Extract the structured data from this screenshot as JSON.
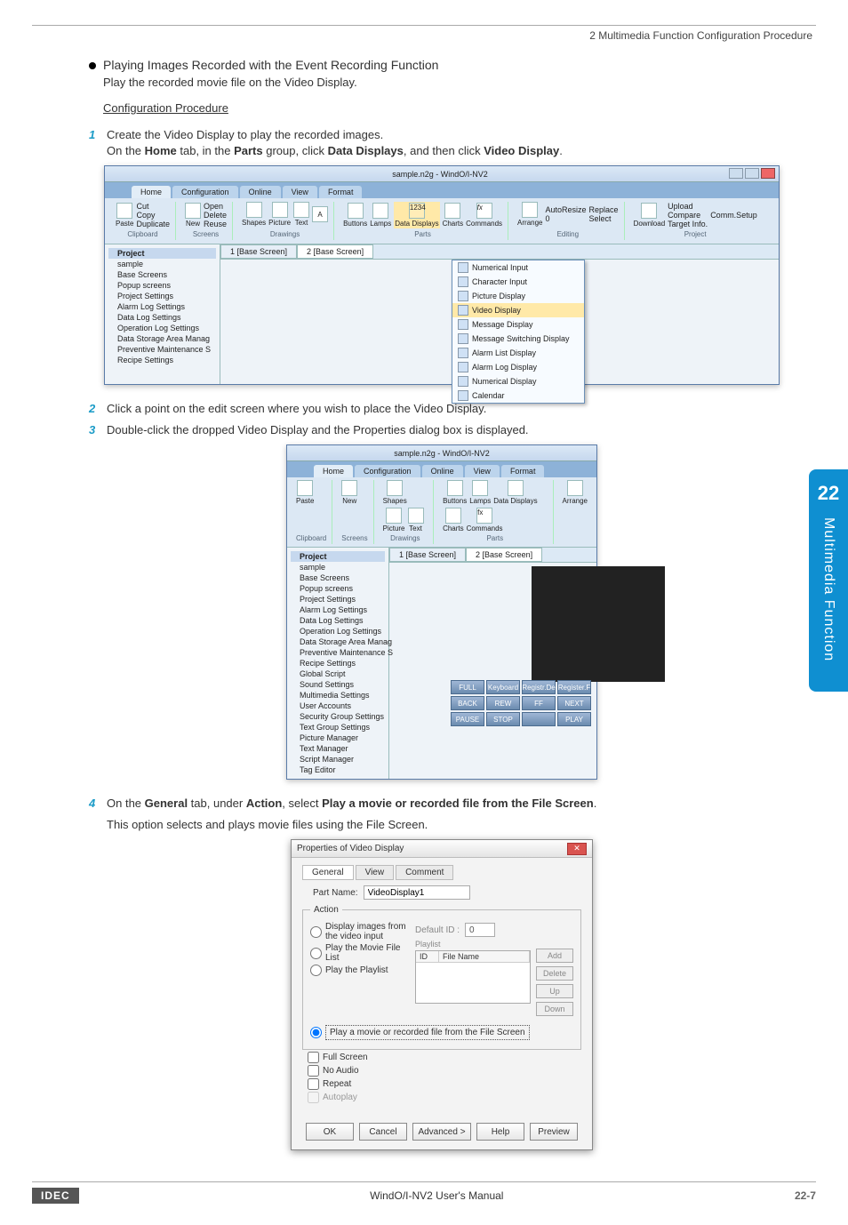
{
  "header": {
    "chapter": "2 Multimedia Function Configuration Procedure"
  },
  "section": {
    "bullet_title": "Playing Images Recorded with the Event Recording Function",
    "bullet_sub": "Play the recorded movie file on the Video Display.",
    "config_heading": "Configuration Procedure"
  },
  "steps": {
    "s1_num": "1",
    "s1_a": "Create the Video Display to play the recorded images.",
    "s1_b_pre": "On the ",
    "s1_b_home": "Home",
    "s1_b_mid1": " tab, in the ",
    "s1_b_parts": "Parts",
    "s1_b_mid2": " group, click ",
    "s1_b_dd": "Data Displays",
    "s1_b_mid3": ", and then click ",
    "s1_b_vd": "Video Display",
    "s1_b_end": ".",
    "s2_num": "2",
    "s2": "Click a point on the edit screen where you wish to place the Video Display.",
    "s3_num": "3",
    "s3": "Double-click the dropped Video Display and the Properties dialog box is displayed.",
    "s4_num": "4",
    "s4_pre": "On the ",
    "s4_general": "General",
    "s4_mid1": " tab, under ",
    "s4_action": "Action",
    "s4_mid2": ", select ",
    "s4_opt": "Play a movie or recorded file from the File Screen",
    "s4_end": ".",
    "s4_sub": "This option selects and plays movie files using the File Screen."
  },
  "app": {
    "title": "sample.n2g - WindO/I-NV2",
    "tabs": {
      "home": "Home",
      "config": "Configuration",
      "online": "Online",
      "view": "View",
      "format": "Format"
    },
    "ribbon": {
      "clipboard": {
        "label": "Clipboard",
        "cut": "Cut",
        "copy": "Copy",
        "paste": "Paste",
        "dup": "Duplicate"
      },
      "screens": {
        "label": "Screens",
        "new": "New",
        "open": "Open",
        "delete": "Delete",
        "reuse": "Reuse"
      },
      "drawings": {
        "label": "Drawings",
        "shapes": "Shapes",
        "picture": "Picture",
        "text": "Text",
        "a": "A"
      },
      "parts": {
        "label": "Parts",
        "buttons": "Buttons",
        "lamps": "Lamps",
        "data": "Data Displays",
        "charts": "Charts",
        "commands": "Commands",
        "fx": "fx"
      },
      "editing": {
        "label": "Editing",
        "arrange": "Arrange",
        "auto": "AutoResize",
        "zero": "0",
        "replace": "Replace",
        "select": "Select"
      },
      "project": {
        "label": "Project",
        "download": "Download",
        "upload": "Upload",
        "compare": "Compare",
        "target": "Target Info.",
        "comm": "Comm.Setup"
      }
    },
    "doctabs": {
      "t1": "1  [Base Screen]",
      "t2": "2  [Base Screen]"
    },
    "tree": {
      "label": "Project",
      "items": [
        "sample",
        "Base Screens",
        "Popup screens",
        "Project Settings",
        "Alarm Log Settings",
        "Data Log Settings",
        "Operation Log Settings",
        "Data Storage Area Manag",
        "Preventive Maintenance S",
        "Recipe Settings"
      ]
    },
    "dropdown": {
      "items": [
        "Numerical Input",
        "Character Input",
        "Picture Display",
        "Video Display",
        "Message Display",
        "Message Switching Display",
        "Alarm List Display",
        "Alarm Log Display",
        "Numerical Display",
        "Calendar"
      ],
      "highlight_index": 3
    }
  },
  "app_small": {
    "tree_extra": [
      "Global Script",
      "Sound Settings",
      "Multimedia Settings",
      "User Accounts",
      "Security Group Settings",
      "Text Group Settings",
      "Picture Manager",
      "Text Manager",
      "Script Manager",
      "Tag Editor"
    ],
    "keys": [
      "FULL",
      "Keyboard",
      "Registr.De",
      "Register.F",
      "BACK",
      "REW",
      "FF",
      "NEXT",
      "PAUSE",
      "STOP",
      "",
      "PLAY"
    ]
  },
  "dialog": {
    "title": "Properties of Video Display",
    "tabs": {
      "general": "General",
      "view": "View",
      "comment": "Comment"
    },
    "part_label": "Part Name:",
    "part_value": "VideoDisplay1",
    "action_legend": "Action",
    "radios": {
      "r1": "Display images from the video input",
      "r2": "Play the Movie File List",
      "r3": "Play the Playlist",
      "r4": "Play a movie or recorded file from the File Screen"
    },
    "default_id_label": "Default ID :",
    "default_id_value": "0",
    "playlist_label": "Playlist",
    "list_cols": {
      "id": "ID",
      "fname": "File Name"
    },
    "side_btns": {
      "add": "Add",
      "del": "Delete",
      "up": "Up",
      "down": "Down"
    },
    "checks": {
      "full": "Full Screen",
      "noaudio": "No Audio",
      "repeat": "Repeat",
      "autoplay": "Autoplay"
    },
    "buttons": {
      "ok": "OK",
      "cancel": "Cancel",
      "adv": "Advanced >",
      "help": "Help",
      "preview": "Preview"
    }
  },
  "sidetab": {
    "num": "22",
    "text": "Multimedia Function"
  },
  "footer": {
    "logo": "IDEC",
    "center": "WindO/I-NV2 User's Manual",
    "page": "22-7"
  }
}
